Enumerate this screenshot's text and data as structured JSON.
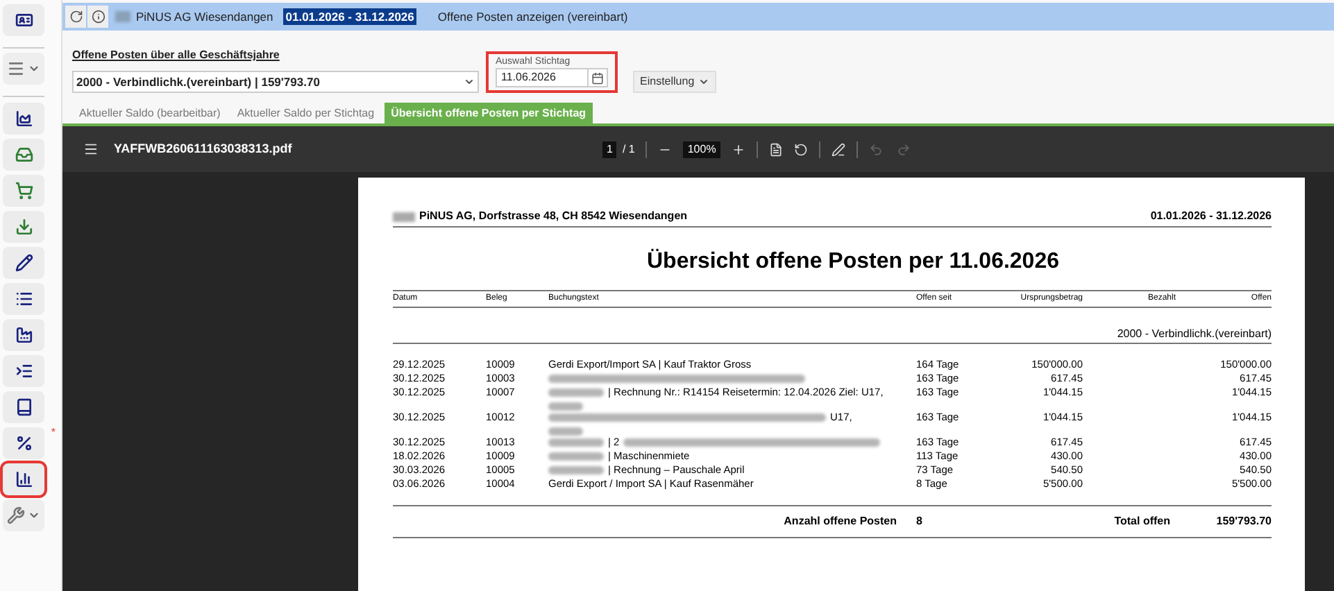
{
  "sidebar": {
    "items": [
      {
        "selected": false
      },
      {
        "selected": false,
        "dropdown": true
      },
      {
        "selected": false
      },
      {
        "selected": false
      },
      {
        "selected": false
      },
      {
        "selected": false
      },
      {
        "selected": false
      },
      {
        "selected": false
      },
      {
        "selected": false
      },
      {
        "selected": false
      },
      {
        "selected": false
      },
      {
        "selected": false,
        "badge": "*"
      },
      {
        "selected": true
      },
      {
        "selected": false,
        "dropdown": true
      }
    ]
  },
  "top_bar": {
    "company": "PiNUS AG Wiesendangen",
    "period": "01.01.2026 - 31.12.2026",
    "title": "Offene Posten anzeigen (vereinbart)"
  },
  "form": {
    "heading": "Offene Posten über alle Geschäftsjahre",
    "account": "2000 - Verbindlichk.(vereinbart) | 159'793.70",
    "date_label": "Auswahl Stichtag",
    "date": "11.06.2026",
    "settings_button": "Einstellung"
  },
  "tabs": [
    {
      "label": "Aktueller Saldo (bearbeitbar)",
      "selected": false
    },
    {
      "label": "Aktueller Saldo per Stichtag",
      "selected": false
    },
    {
      "label": "Übersicht offene Posten per Stichtag",
      "selected": true
    }
  ],
  "viewer": {
    "filename": "YAFFWB260611163038313.pdf",
    "page": "1",
    "pages": "/ 1",
    "zoom": "100%"
  },
  "document": {
    "company": "PiNUS AG, Dorfstrasse 48, CH 8542 Wiesendangen",
    "period": "01.01.2026 - 31.12.2026",
    "title": "Übersicht offene Posten per 11.06.2026",
    "columns": [
      "Datum",
      "Beleg",
      "Buchungstext",
      "Offen seit",
      "Ursprungsbetrag",
      "Bezahlt",
      "Offen"
    ],
    "account": "2000 - Verbindlichk.(vereinbart)",
    "rows": [
      {
        "date": "29.12.2025",
        "voucher": "10009",
        "parts": [
          {
            "kind": "text",
            "text": "Gerdi Export/Import SA | Kauf Traktor Gross"
          }
        ],
        "age": "164 Tage",
        "amount": "150'000.00",
        "open": "150'000.00"
      },
      {
        "date": "30.12.2025",
        "voucher": "10003",
        "parts": [
          {
            "kind": "blur_long"
          }
        ],
        "age": "163 Tage",
        "amount": "617.45",
        "open": "617.45"
      },
      {
        "date": "30.12.2025",
        "voucher": "10007",
        "parts": [
          {
            "kind": "blur"
          },
          {
            "kind": "text",
            "text": "| Rechnung Nr.: R14154 Reisetermin: 12.04.2026 Ziel: U17,"
          },
          {
            "kind": "blur_line"
          }
        ],
        "age": "163 Tage",
        "amount": "1'044.15",
        "open": "1'044.15"
      },
      {
        "date": "30.12.2025",
        "voucher": "10012",
        "parts": [
          {
            "kind": "blur_wide"
          },
          {
            "kind": "text",
            "text": "U17,"
          },
          {
            "kind": "blur_line"
          }
        ],
        "age": "163 Tage",
        "amount": "1'044.15",
        "open": "1'044.15"
      },
      {
        "date": "30.12.2025",
        "voucher": "10013",
        "parts": [
          {
            "kind": "blur"
          },
          {
            "kind": "text",
            "text": "| 2"
          },
          {
            "kind": "blur_long"
          }
        ],
        "age": "163 Tage",
        "amount": "617.45",
        "open": "617.45"
      },
      {
        "date": "18.02.2026",
        "voucher": "10009",
        "parts": [
          {
            "kind": "blur"
          },
          {
            "kind": "text",
            "text": "| Maschinenmiete"
          }
        ],
        "age": "113 Tage",
        "amount": "430.00",
        "open": "430.00"
      },
      {
        "date": "30.03.2026",
        "voucher": "10005",
        "parts": [
          {
            "kind": "blur"
          },
          {
            "kind": "text",
            "text": "| Rechnung – Pauschale April"
          }
        ],
        "age": "73 Tage",
        "amount": "540.50",
        "open": "540.50"
      },
      {
        "date": "03.06.2026",
        "voucher": "10004",
        "parts": [
          {
            "kind": "text",
            "text": "Gerdi Export / Import SA | Kauf Rasenmäher"
          }
        ],
        "age": "8 Tage",
        "amount": "5'500.00",
        "open": "5'500.00"
      }
    ],
    "count_label": "Anzahl offene Posten",
    "count": "8",
    "total_label": "Total offen",
    "total": "159'793.70"
  }
}
